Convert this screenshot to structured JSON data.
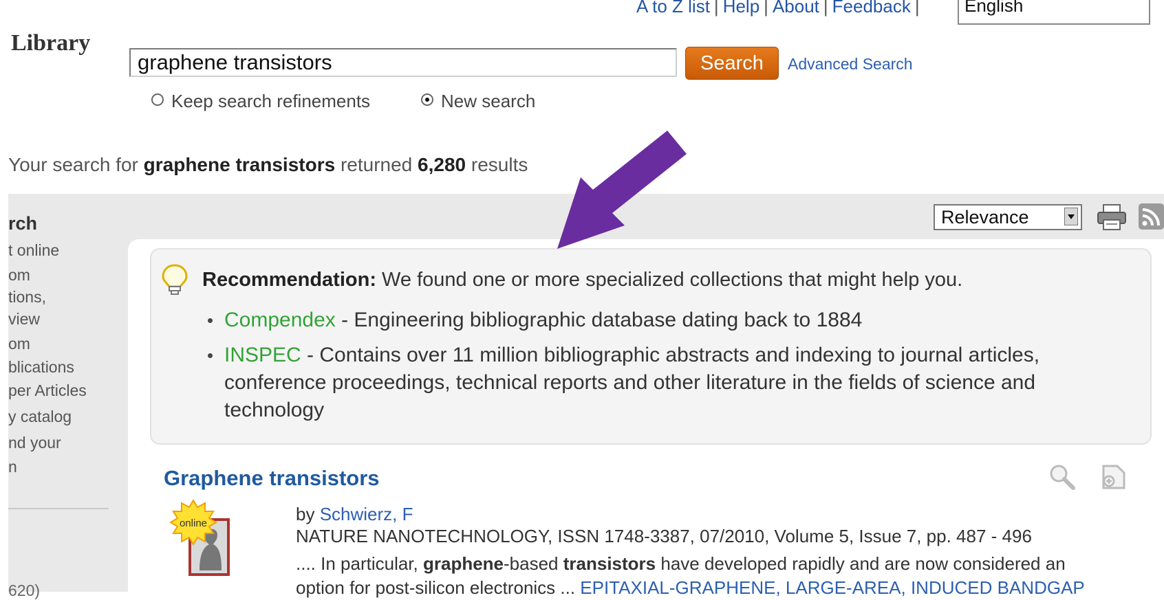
{
  "header": {
    "top_links": [
      "A to Z list",
      "Help",
      "About",
      "Feedback"
    ],
    "language": "English",
    "logo": "Library"
  },
  "search": {
    "query": "graphene transistors",
    "button_label": "Search",
    "advanced_label": "Advanced Search",
    "option_keep": "Keep search refinements",
    "option_new": "New search",
    "selected_option": "New search"
  },
  "summary": {
    "prefix": "Your search for ",
    "query": "graphene transistors",
    "middle": " returned ",
    "count": "6,280",
    "suffix": " results"
  },
  "sidebar": {
    "heading": "rch",
    "items": [
      "t online",
      "om",
      "tions,",
      "view",
      "om",
      "blications",
      "per Articles",
      "y catalog",
      "nd your",
      "n"
    ],
    "count_fragment": "620)"
  },
  "toolbar": {
    "sort_value": "Relevance",
    "icons": [
      "print-icon",
      "rss-icon"
    ]
  },
  "recommendation": {
    "label": "Recommendation:",
    "text": " We found one or more specialized collections that might help you.",
    "items": [
      {
        "name": "Compendex",
        "description": " - Engineering bibliographic database dating back to 1884"
      },
      {
        "name": "INSPEC",
        "description": " - Contains over 11 million bibliographic abstracts and indexing to journal articles, conference proceedings, technical reports and other literature in the fields of science and technology"
      }
    ]
  },
  "result": {
    "title": "Graphene transistors",
    "badge": "online",
    "author_prefix": "by ",
    "author": "Schwierz, F",
    "source": "NATURE NANOTECHNOLOGY, ISSN 1748-3387, 07/2010, Volume 5, Issue 7, pp. 487 - 496",
    "snippet_start": ".... In particular, ",
    "snippet_bold1": "graphene",
    "snippet_mid": "-based ",
    "snippet_bold2": "transistors",
    "snippet_end": " have developed rapidly and are now considered an",
    "snippet_line2": "option for post-silicon electronics ...",
    "subjects": " EPITAXIAL-GRAPHENE, LARGE-AREA, INDUCED BANDGAP"
  },
  "colors": {
    "accent_orange": "#d86a10",
    "link_blue": "#2c5fb0",
    "title_blue": "#1f5aa0",
    "link_green": "#31a336",
    "arrow_purple": "#6a2d9f"
  }
}
